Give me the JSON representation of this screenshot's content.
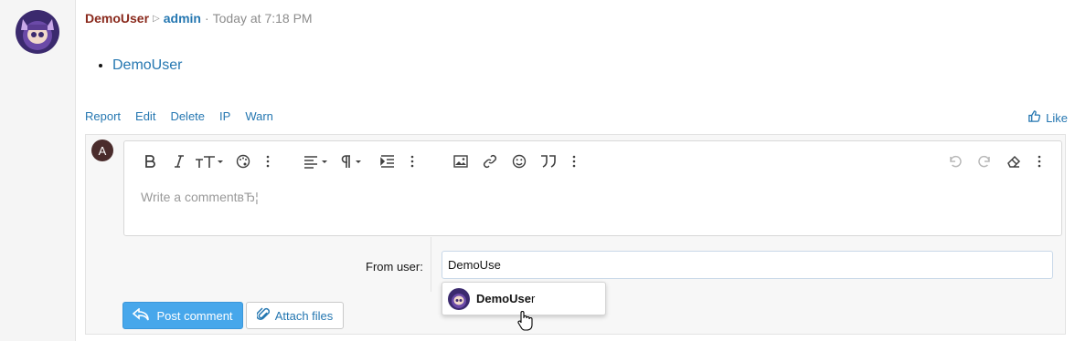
{
  "post": {
    "author": "DemoUser",
    "recipient": "admin",
    "separator": "·",
    "timestamp": "Today at 7:18 PM",
    "content_link": "DemoUser",
    "actions": [
      "Report",
      "Edit",
      "Delete",
      "IP",
      "Warn"
    ],
    "like_label": "Like"
  },
  "reply": {
    "avatar_letter": "A",
    "placeholder": "Write a commentвЂ¦",
    "toolbar_icons": [
      "bold-icon",
      "italic-icon",
      "text-size-icon",
      "palette-icon",
      "more-icon",
      "align-icon",
      "paragraph-icon",
      "indent-icon",
      "more-icon",
      "image-icon",
      "link-icon",
      "smiley-icon",
      "quote-icon",
      "more-icon",
      "undo-icon",
      "redo-icon",
      "eraser-icon",
      "more-icon"
    ],
    "from_user_label": "From user:",
    "from_user_value": "DemoUse",
    "suggestion": {
      "bold": "DemoUse",
      "rest": "r"
    },
    "post_button": "Post comment",
    "attach_button": "Attach files"
  },
  "colors": {
    "accent": "#2577b1",
    "author": "#8a2a1d",
    "primary_button": "#47a7eb"
  }
}
